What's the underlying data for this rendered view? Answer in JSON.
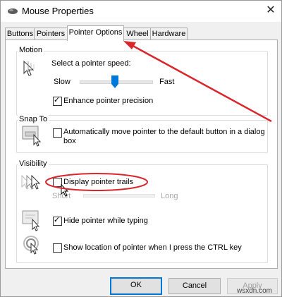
{
  "window": {
    "title": "Mouse Properties"
  },
  "tabs": [
    "Buttons",
    "Pointers",
    "Pointer Options",
    "Wheel",
    "Hardware"
  ],
  "motion": {
    "group_label": "Motion",
    "speed_label": "Select a pointer speed:",
    "slow_label": "Slow",
    "fast_label": "Fast",
    "speed_value": 0.5,
    "precision_label": "Enhance pointer precision",
    "precision_checked": true
  },
  "snap_to": {
    "group_label": "Snap To",
    "option_label_line1": "Automatically move pointer to the default button in a dialog",
    "option_label_line2": "box",
    "checked": false
  },
  "visibility": {
    "group_label": "Visibility",
    "trails_label": "Display pointer trails",
    "trails_checked": false,
    "short_label": "Short",
    "long_label": "Long",
    "hide_label": "Hide pointer while typing",
    "hide_checked": true,
    "ctrl_label": "Show location of pointer when I press the CTRL key",
    "ctrl_checked": false
  },
  "buttons": {
    "ok": "OK",
    "cancel": "Cancel",
    "apply": "Apply"
  },
  "watermark": "wsxdn.com",
  "colors": {
    "annotation_red": "#d9262c",
    "accent": "#0078d7",
    "slider_thumb": "#0078d7"
  }
}
